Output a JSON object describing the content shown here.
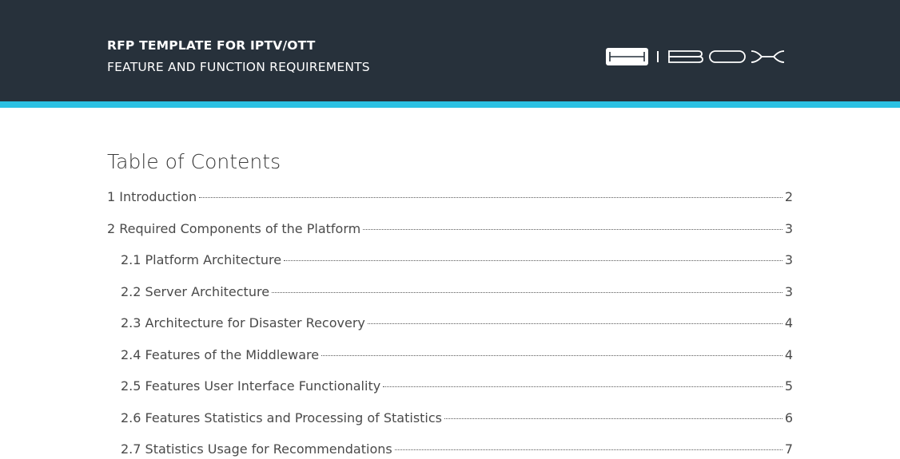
{
  "header": {
    "title": "RFP TEMPLATE FOR IPTV/OTT",
    "subtitle": "FEATURE AND FUNCTION REQUIREMENTS",
    "logo_text": "HIBOX",
    "background_color": "#27313b",
    "accent_color": "#2cc1e3"
  },
  "toc": {
    "heading": "Table of Contents",
    "entries": [
      {
        "label": "1 Introduction",
        "page": "2",
        "level": 1
      },
      {
        "label": "2 Required Components of the Platform",
        "page": "3",
        "level": 1
      },
      {
        "label": "2.1 Platform Architecture",
        "page": "3",
        "level": 2
      },
      {
        "label": "2.2 Server Architecture",
        "page": "3",
        "level": 2
      },
      {
        "label": "2.3 Architecture for Disaster Recovery",
        "page": "4",
        "level": 2
      },
      {
        "label": "2.4 Features of the Middleware",
        "page": "4",
        "level": 2
      },
      {
        "label": "2.5 Features User Interface Functionality",
        "page": "5",
        "level": 2
      },
      {
        "label": "2.6 Features Statistics and Processing of Statistics",
        "page": "6",
        "level": 2
      },
      {
        "label": "2.7 Statistics Usage for Recommendations",
        "page": "7",
        "level": 2
      }
    ]
  }
}
